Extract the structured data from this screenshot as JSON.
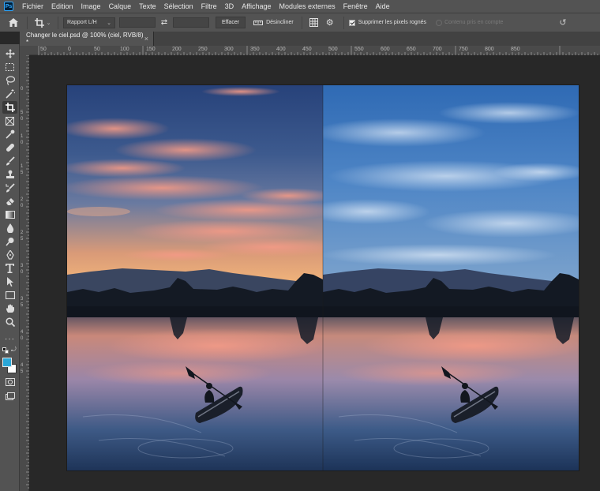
{
  "app": {
    "logo": "Ps"
  },
  "menu": [
    "Fichier",
    "Edition",
    "Image",
    "Calque",
    "Texte",
    "Sélection",
    "Filtre",
    "3D",
    "Affichage",
    "Modules externes",
    "Fenêtre",
    "Aide"
  ],
  "options": {
    "ratio_select": "Rapport L/H",
    "clear_button": "Effacer",
    "straighten_label": "Désincliner",
    "delete_cropped_label": "Supprimer les pixels rognés",
    "content_aware_label": "Contenu pris en compte",
    "delete_cropped_checked": true
  },
  "document_tab": {
    "title": "Changer le ciel.psd @ 100% (ciel, RVB/8) *",
    "close": "×"
  },
  "ruler_h": [
    "50",
    "0",
    "50",
    "100",
    "150",
    "200",
    "250",
    "300",
    "350",
    "400",
    "450",
    "500",
    "550",
    "600",
    "650",
    "700",
    "750",
    "800",
    "850"
  ],
  "ruler_v": [
    "0",
    "5",
    "0",
    "1",
    "0",
    "1",
    "5",
    "2",
    "0",
    "2",
    "5",
    "3",
    "0",
    "3",
    "5",
    "4",
    "0",
    "4",
    "5"
  ],
  "toolbar": {
    "tools": [
      "move-icon",
      "marquee-icon",
      "lasso-icon",
      "magic-wand-icon",
      "crop-icon",
      "frame-icon",
      "eyedropper-icon",
      "healing-icon",
      "brush-icon",
      "stamp-icon",
      "history-brush-icon",
      "eraser-icon",
      "gradient-icon",
      "blur-icon",
      "dodge-icon",
      "pen-icon",
      "type-icon",
      "path-select-icon",
      "rectangle-icon",
      "hand-icon",
      "zoom-icon",
      "more-icon"
    ],
    "foreground_color": "#2aa7d8",
    "background_color": "#ffffff"
  }
}
